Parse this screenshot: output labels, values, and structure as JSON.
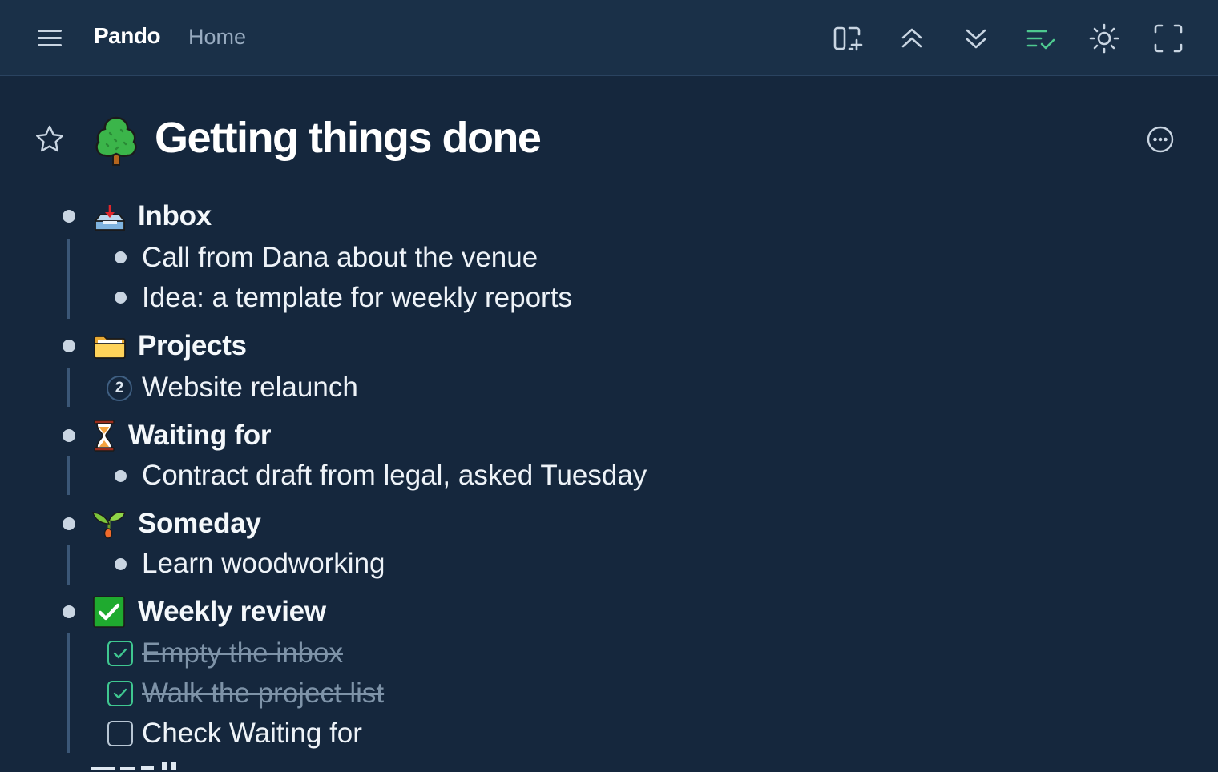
{
  "app": {
    "name": "Pando",
    "breadcrumb": "Home"
  },
  "toolbar": {
    "buttons": [
      {
        "icon": "add-panel-icon",
        "name": "add-panel-button"
      },
      {
        "icon": "collapse-all-icon",
        "name": "collapse-all-button"
      },
      {
        "icon": "expand-all-icon",
        "name": "expand-all-button"
      },
      {
        "icon": "show-completed-icon",
        "name": "show-completed-button",
        "active_color": "#4ec98f"
      },
      {
        "icon": "sun-icon",
        "name": "theme-toggle-button"
      },
      {
        "icon": "fullscreen-icon",
        "name": "fullscreen-button"
      }
    ]
  },
  "page": {
    "title": "Getting things done",
    "title_icon": "tree-icon",
    "favorite_icon": "star-icon",
    "menu_icon": "more-icon"
  },
  "outline": [
    {
      "heading": "Inbox",
      "icon": "inbox-tray-icon",
      "children": [
        {
          "text": "Call from Dana about the venue",
          "kind": "bullet"
        },
        {
          "text": "Idea: a template for weekly reports",
          "kind": "bullet"
        }
      ]
    },
    {
      "heading": "Projects",
      "icon": "folder-icon",
      "children": [
        {
          "text": "Website relaunch",
          "kind": "collapsed",
          "child_count": "2"
        }
      ]
    },
    {
      "heading": "Waiting for",
      "icon": "hourglass-icon",
      "children": [
        {
          "text": "Contract draft from legal, asked Tuesday",
          "kind": "bullet"
        }
      ]
    },
    {
      "heading": "Someday",
      "icon": "seedling-icon",
      "children": [
        {
          "text": "Learn woodworking",
          "kind": "bullet"
        }
      ]
    },
    {
      "heading": "Weekly review",
      "icon": "check-mark-button-icon",
      "children": [
        {
          "text": "Empty the inbox",
          "kind": "todo",
          "done": true
        },
        {
          "text": "Walk the project list",
          "kind": "todo",
          "done": true
        },
        {
          "text": "Check Waiting for",
          "kind": "todo",
          "done": false
        }
      ]
    }
  ],
  "colors": {
    "background": "#15273d",
    "topbar": "#1a3048",
    "accent_green": "#3fc790",
    "muted_text": "#7e93a8"
  }
}
